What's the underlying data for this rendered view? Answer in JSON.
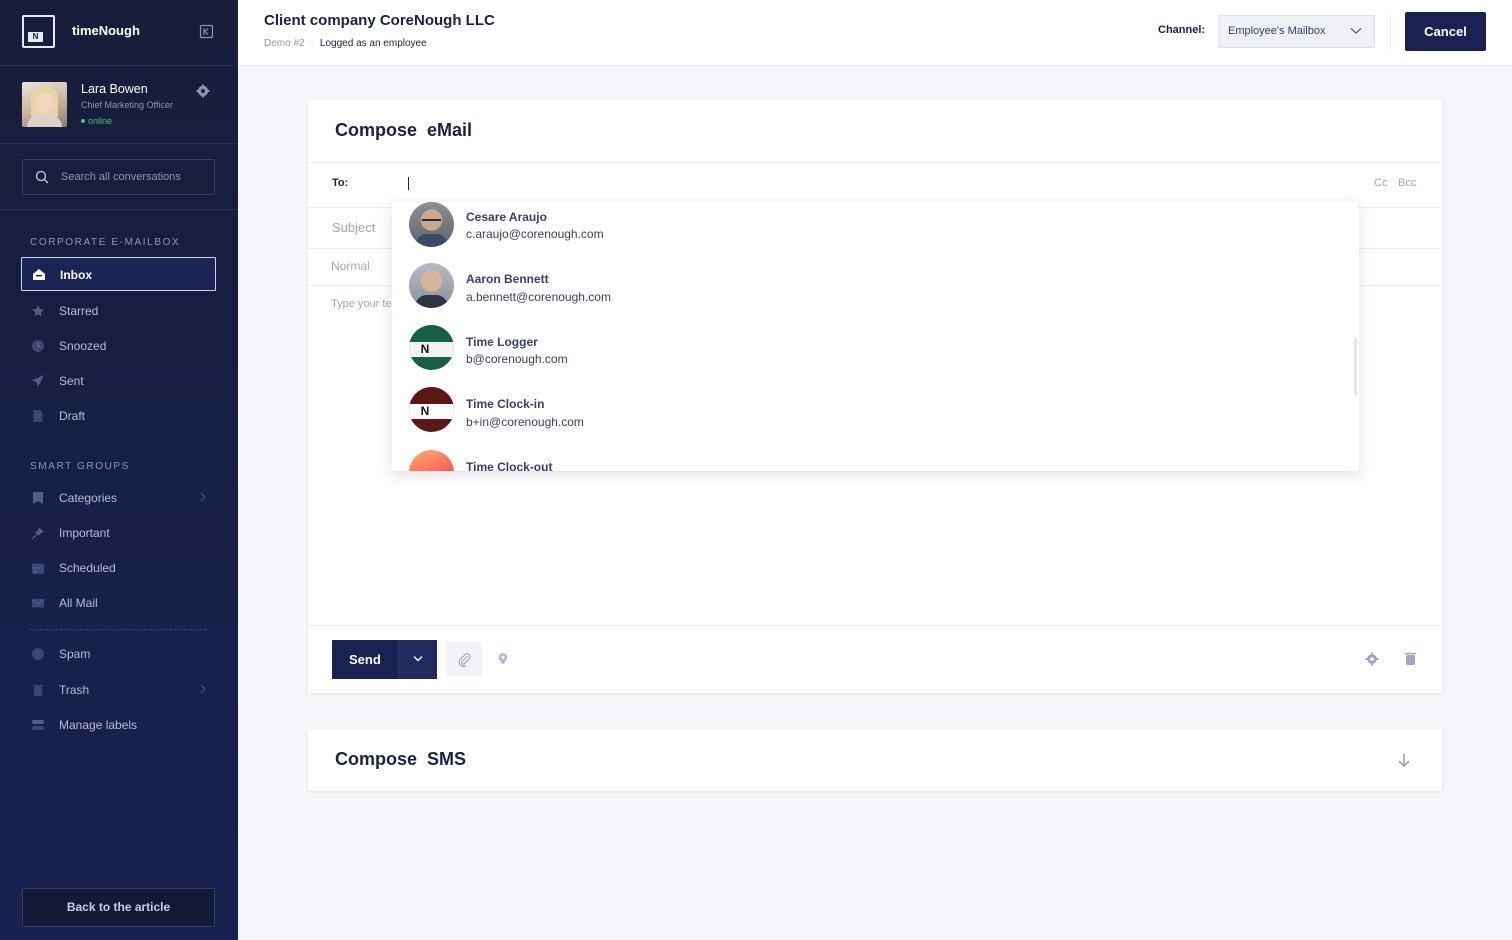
{
  "app": {
    "brand": "timeNough",
    "logo_mark": "N"
  },
  "profile": {
    "name": "Lara Bowen",
    "role": "Chief Marketing Officer",
    "status": "online"
  },
  "search": {
    "placeholder": "Search all conversations"
  },
  "sections": {
    "mailbox": "CORPORATE E-MAILBOX",
    "smart": "SMART GROUPS"
  },
  "nav": {
    "inbox": "Inbox",
    "starred": "Starred",
    "snoozed": "Snoozed",
    "sent": "Sent",
    "draft": "Draft",
    "categories": "Categories",
    "important": "Important",
    "scheduled": "Scheduled",
    "all_mail": "All Mail",
    "spam": "Spam",
    "trash": "Trash",
    "manage_labels": "Manage labels"
  },
  "back_button": "Back to the article",
  "header": {
    "title": "Client company CoreNough LLC",
    "crumb_demo": "Demo #2",
    "crumb_sep": "-",
    "crumb_logged": "Logged as an employee",
    "channel_label": "Channel:",
    "channel_value": "Employee's Mailbox",
    "cancel": "Cancel"
  },
  "compose_email": {
    "title": "Compose  eMail",
    "to_label": "To:",
    "cc": "Cc",
    "bcc": "Bcc",
    "subject_placeholder": "Subject",
    "format_value": "Normal",
    "body_placeholder": "Type your text",
    "send": "Send"
  },
  "recipients": [
    {
      "name": "Cesare Araujo",
      "email": "c.araujo@corenough.com"
    },
    {
      "name": "Aaron Bennett",
      "email": "a.bennett@corenough.com"
    },
    {
      "name": "Time Logger",
      "email": "b@corenough.com"
    },
    {
      "name": "Time Clock-in",
      "email": "b+in@corenough.com"
    },
    {
      "name": "Time Clock-out",
      "email": ""
    }
  ],
  "compose_sms": {
    "title": "Compose  SMS"
  },
  "colors": {
    "sidebar_bg": "#171d3a",
    "primary": "#1b2150",
    "online": "#4ec27d"
  }
}
